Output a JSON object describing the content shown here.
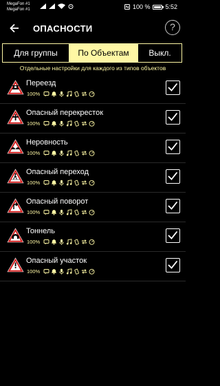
{
  "status_bar": {
    "carrier_1": "MegaFon #1",
    "carrier_2": "MegaFon #1",
    "battery": "100 %",
    "time": "5:52"
  },
  "header": {
    "title": "ОПАСНОСТИ",
    "back_icon": "arrow-back-icon",
    "help_label": "?"
  },
  "tabs": [
    {
      "label": "Для группы",
      "active": false
    },
    {
      "label": "По Объектам",
      "active": true
    },
    {
      "label": "Выкл.",
      "active": false
    }
  ],
  "subtitle": "Отдельные настройки для каждого из типов объектов",
  "colors": {
    "accent": "#fef7a4",
    "sign_red": "#d42020",
    "background": "#000000"
  },
  "items": [
    {
      "name": "Переезд",
      "percent": "100%",
      "sign": "railway-crossing-sign-icon",
      "checked": true
    },
    {
      "name": "Опасный перекресток",
      "percent": "100%",
      "sign": "dangerous-intersection-sign-icon",
      "checked": true
    },
    {
      "name": "Неровность",
      "percent": "100%",
      "sign": "uneven-road-sign-icon",
      "checked": true
    },
    {
      "name": "Опасный переход",
      "percent": "100%",
      "sign": "pedestrian-crossing-sign-icon",
      "checked": true
    },
    {
      "name": "Опасный поворот",
      "percent": "100%",
      "sign": "dangerous-turn-sign-icon",
      "checked": true
    },
    {
      "name": "Тоннель",
      "percent": "100%",
      "sign": "tunnel-sign-icon",
      "checked": true
    },
    {
      "name": "Опасный участок",
      "percent": "100%",
      "sign": "danger-sign-icon",
      "checked": true
    }
  ],
  "meta_icons": [
    "message-icon",
    "bell-icon",
    "mic-icon",
    "music-icon",
    "vibration-icon",
    "repeat-icon",
    "speedometer-icon"
  ]
}
